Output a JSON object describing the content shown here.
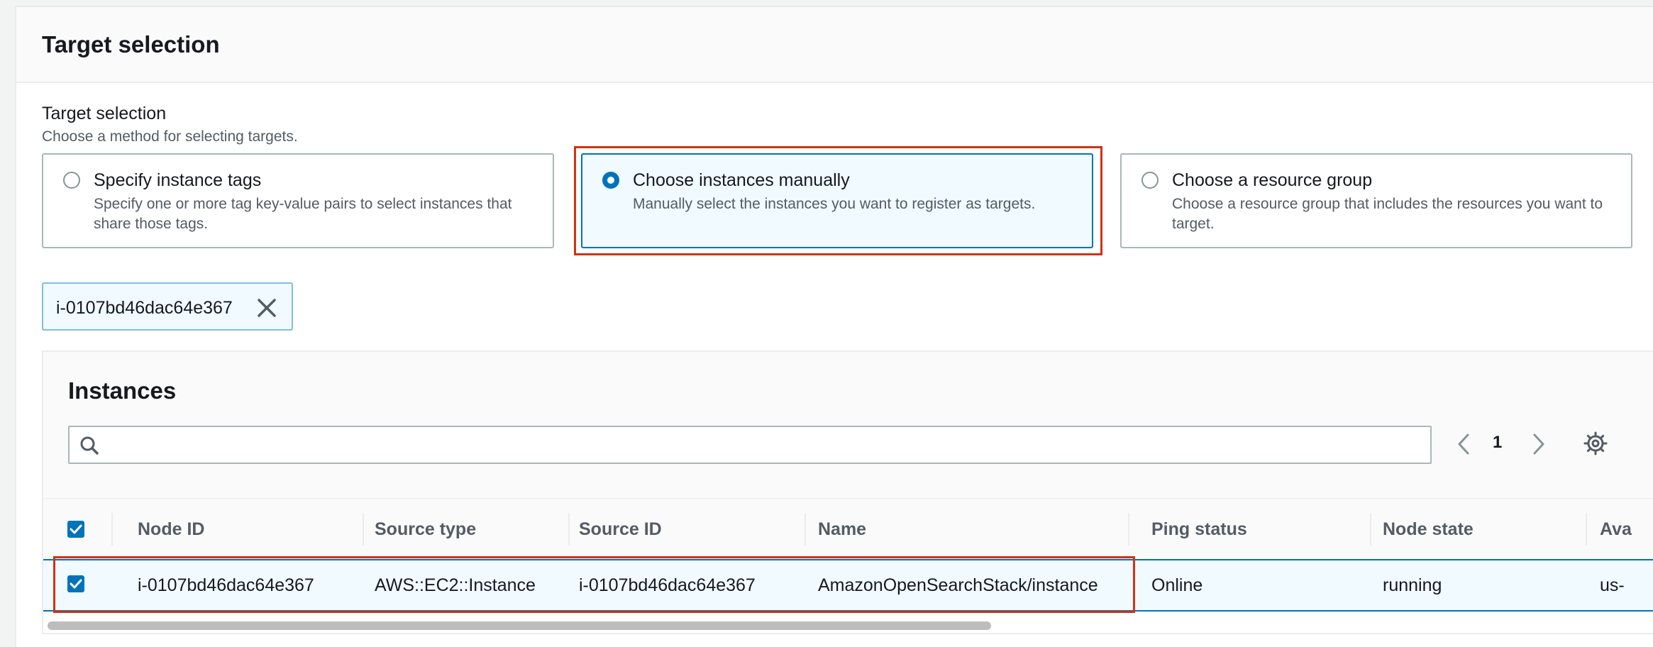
{
  "panel": {
    "title": "Target selection"
  },
  "field": {
    "label": "Target selection",
    "description": "Choose a method for selecting targets."
  },
  "tiles": [
    {
      "title": "Specify instance tags",
      "description": "Specify one or more tag key-value pairs to select instances that share those tags.",
      "selected": false
    },
    {
      "title": "Choose instances manually",
      "description": "Manually select the instances you want to register as targets.",
      "selected": true
    },
    {
      "title": "Choose a resource group",
      "description": "Choose a resource group that includes the resources you want to target.",
      "selected": false
    }
  ],
  "token": {
    "label": "i-0107bd46dac64e367",
    "remove_icon": "close-icon"
  },
  "instances": {
    "title": "Instances",
    "search": {
      "placeholder": "",
      "value": "",
      "icon": "search-icon"
    },
    "pagination": {
      "current_page": "1",
      "prev_icon": "chevron-left-icon",
      "next_icon": "chevron-right-icon"
    },
    "settings_icon": "gear-icon",
    "columns": [
      "Node ID",
      "Source type",
      "Source ID",
      "Name",
      "Ping status",
      "Node state",
      "Ava"
    ],
    "rows": [
      {
        "selected": true,
        "cells": [
          "i-0107bd46dac64e367",
          "AWS::EC2::Instance",
          "i-0107bd46dac64e367",
          "AmazonOpenSearchStack/instance",
          "Online",
          "running",
          "us-"
        ]
      }
    ]
  },
  "colors": {
    "accent": "#0073bb",
    "highlight": "#d13212",
    "selected_bg": "#f1faff"
  }
}
